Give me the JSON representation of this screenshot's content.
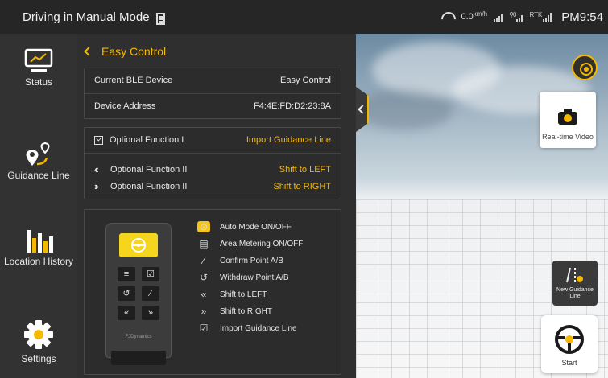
{
  "statusbar": {
    "mode": "Driving in Manual Mode",
    "speed": "0.0",
    "speed_unit": "km/h",
    "rtk_label": "RTK",
    "time": "PM9:54"
  },
  "sidebar": {
    "items": [
      {
        "label": "Status",
        "icon": "monitor-icon"
      },
      {
        "label": "Guidance Line",
        "icon": "route-pin-icon"
      },
      {
        "label": "Location History",
        "icon": "bar-chart-icon"
      },
      {
        "label": "Settings",
        "icon": "gear-icon"
      }
    ]
  },
  "panel": {
    "title": "Easy Control",
    "device": {
      "ble_label": "Current BLE Device",
      "ble_value": "Easy Control",
      "address_label": "Device Address",
      "address_value": "F4:4E:FD:D2:23:8A"
    },
    "functions": [
      {
        "label": "Optional Function I",
        "value": "Import Guidance Line",
        "icon": "checkbox-icon"
      },
      {
        "label": "Optional Function II",
        "value": "Shift to LEFT",
        "icon": "double-left-icon"
      },
      {
        "label": "Optional Function II",
        "value": "Shift to RIGHT",
        "icon": "double-right-icon"
      }
    ],
    "legend": [
      {
        "label": "Auto Mode ON/OFF",
        "icon": "steering-wheel-icon"
      },
      {
        "label": "Area Metering ON/OFF",
        "icon": "list-icon"
      },
      {
        "label": "Confirm Point A/B",
        "icon": "line-icon"
      },
      {
        "label": "Withdraw Point A/B",
        "icon": "undo-icon"
      },
      {
        "label": "Shift to LEFT",
        "icon": "double-left-icon"
      },
      {
        "label": "Shift to RIGHT",
        "icon": "double-right-icon"
      },
      {
        "label": "Import Guidance Line",
        "icon": "checkbox-icon"
      }
    ],
    "remote_brand": "FJDynamics"
  },
  "scene": {
    "video_label": "Real-time Video",
    "guidance_label": "New Guidance Line",
    "start_label": "Start"
  },
  "colors": {
    "accent": "#f5b800",
    "panel_bg": "#2f2f2f",
    "sidebar_bg": "#323232"
  }
}
